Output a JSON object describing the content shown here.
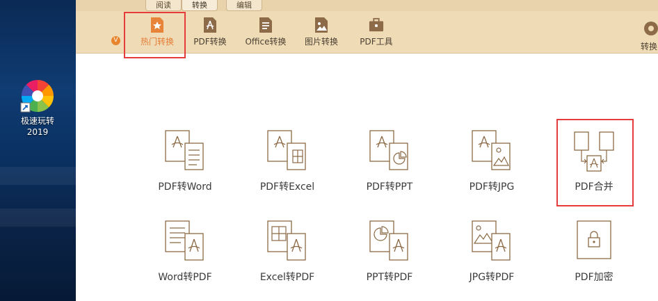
{
  "desktop": {
    "icon_name": "极速玩转",
    "icon_year": "2019"
  },
  "tabs": [
    {
      "label": "阅读",
      "active": false
    },
    {
      "label": "转换",
      "active": true
    },
    {
      "label": "编辑",
      "active": false
    }
  ],
  "ribbon": {
    "dropdown_badge": "V",
    "buttons": [
      {
        "label": "热门转换",
        "icon": "star-file-icon",
        "active": true
      },
      {
        "label": "PDF转换",
        "icon": "pdf-file-icon",
        "active": false
      },
      {
        "label": "Office转换",
        "icon": "office-doc-icon",
        "active": false
      },
      {
        "label": "图片转换",
        "icon": "image-file-icon",
        "active": false
      },
      {
        "label": "PDF工具",
        "icon": "toolbox-icon",
        "active": false
      }
    ],
    "right_partial_label": "转换"
  },
  "tiles": [
    {
      "label": "PDF转Word",
      "icon": "pdf-to-word-icon"
    },
    {
      "label": "PDF转Excel",
      "icon": "pdf-to-excel-icon"
    },
    {
      "label": "PDF转PPT",
      "icon": "pdf-to-ppt-icon"
    },
    {
      "label": "PDF转JPG",
      "icon": "pdf-to-jpg-icon"
    },
    {
      "label": "PDF合并",
      "icon": "pdf-merge-icon"
    },
    {
      "label": "Word转PDF",
      "icon": "word-to-pdf-icon"
    },
    {
      "label": "Excel转PDF",
      "icon": "excel-to-pdf-icon"
    },
    {
      "label": "PPT转PDF",
      "icon": "ppt-to-pdf-icon"
    },
    {
      "label": "JPG转PDF",
      "icon": "jpg-to-pdf-icon"
    },
    {
      "label": "PDF加密",
      "icon": "pdf-encrypt-icon"
    }
  ],
  "colors": {
    "ribbon_bg": "#efdcb7",
    "accent": "#e57b35",
    "icon_stroke": "#8b6a45",
    "highlight_red": "#e53b3b"
  }
}
